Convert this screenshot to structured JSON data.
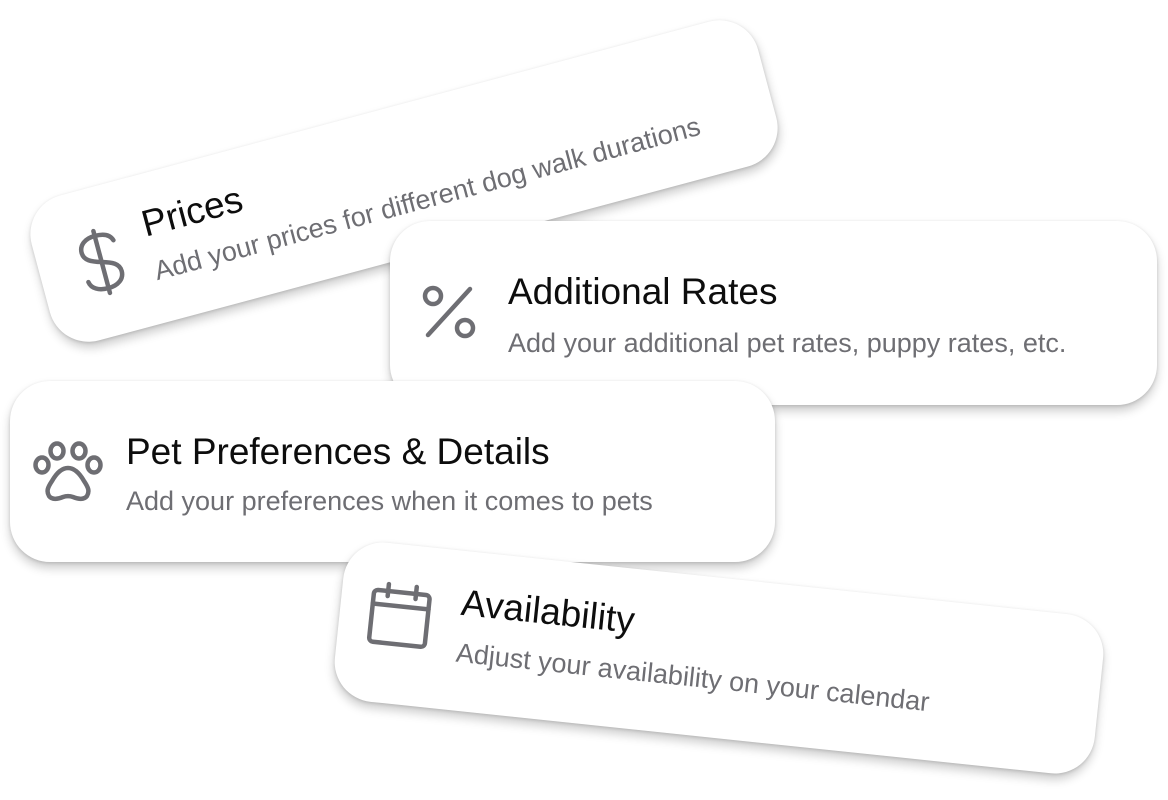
{
  "cards": [
    {
      "id": "prices",
      "title": "Prices",
      "subtitle": "Add your prices for different dog walk durations",
      "icon": "dollar-icon"
    },
    {
      "id": "additional-rates",
      "title": "Additional Rates",
      "subtitle": "Add your additional pet rates, puppy rates, etc.",
      "icon": "percent-icon"
    },
    {
      "id": "pet-preferences",
      "title": "Pet Preferences & Details",
      "subtitle": "Add your preferences when it comes to pets",
      "icon": "paw-icon"
    },
    {
      "id": "availability",
      "title": "Availability",
      "subtitle": "Adjust your availability on your calendar",
      "icon": "calendar-icon"
    }
  ],
  "colors": {
    "background": "#ffffff",
    "card": "#ffffff",
    "title": "#0d0d0d",
    "subtitle": "#6e6e73",
    "icon": "#6e6e73"
  }
}
